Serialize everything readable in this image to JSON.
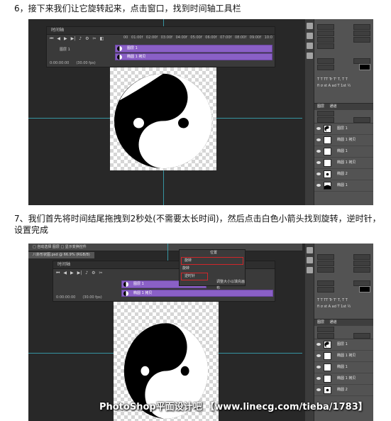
{
  "steps": {
    "step6_text": "6，接下来我们让它旋转起来，点击窗口，找到时间轴工具栏",
    "step7_text": "7、我们首先将时间结尾拖拽到2秒处(不需要太长时间)，然后点击白色小箭头找到旋转，逆时针，设置完成"
  },
  "shot1": {
    "timeline_title": "时间轴",
    "ruler_ticks": [
      "00",
      "01:00f",
      "01:00f",
      "02:00f",
      "03:00f",
      "04:00f",
      "05:00f",
      "06:00f",
      "07:00f",
      "08:00f",
      "09:00f",
      "10:0"
    ],
    "layer1_label": "图层 1",
    "layer1_track": "图层 1",
    "layer2_track": "椭圆 1 拷贝",
    "timecode": "0:00:00:00",
    "fps": "(30.00 fps)",
    "layers_tab": "图层",
    "channels_tab": "通道",
    "kind_label": "类型",
    "blend_mode": "正常",
    "opacity_label": "不透明度:",
    "opacity_value": "100%",
    "fill_label": "填充:",
    "fill_value": "100%",
    "lock_label": "锁定:",
    "layers": [
      {
        "name": "图层 1"
      },
      {
        "name": "椭圆 1 拷贝"
      },
      {
        "name": "椭圆 1"
      },
      {
        "name": "椭圆 1 拷贝"
      },
      {
        "name": "椭圆 2"
      },
      {
        "name": "椭圆 1"
      }
    ]
  },
  "shot2": {
    "menubar": "□ 自动选择  图层  □ 显示变换控件",
    "doc_tab": "八卦形状图.psd @ 66.9% (RGB/8)",
    "timeline_title": "时间轴",
    "popup_title": "位置",
    "popup_item1": "旋转",
    "popup_item2": "旋转",
    "popup_item3": "逆时针",
    "popup_item4": "调整大小以填充画布",
    "layer1_track": "图层 1",
    "layer2_track": "椭圆 1 拷贝",
    "timecode": "0:00:00:00",
    "fps": "(30.00 fps)",
    "layers": [
      {
        "name": "图层 1"
      },
      {
        "name": "椭圆 1 拷贝"
      },
      {
        "name": "椭圆 1"
      },
      {
        "name": "椭圆 1 拷贝"
      },
      {
        "name": "椭圆 2"
      }
    ]
  },
  "watermark": "PhotoShop平面设计吧 【www.linecg.com/tieba/1783】"
}
